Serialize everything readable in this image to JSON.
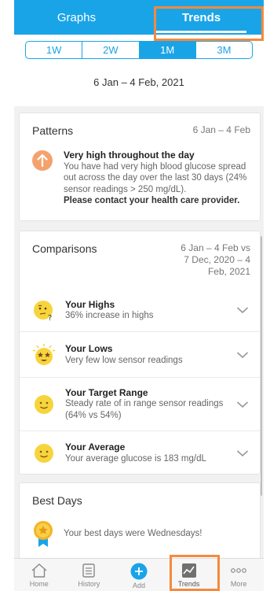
{
  "tabs": [
    {
      "label": "Graphs",
      "active": false
    },
    {
      "label": "Trends",
      "active": true
    }
  ],
  "segments": [
    {
      "label": "1W",
      "active": false
    },
    {
      "label": "2W",
      "active": false
    },
    {
      "label": "1M",
      "active": true
    },
    {
      "label": "3M",
      "active": false
    }
  ],
  "date_range": "6 Jan – 4 Feb, 2021",
  "patterns": {
    "title": "Patterns",
    "date": "6 Jan – 4 Feb",
    "icon": "arrow-up-icon",
    "heading": "Very high throughout the day",
    "body": "You have had very high blood glucose spread out across the day over the last 30 days (24% sensor readings > 250 mg/dL).",
    "contact": "Please contact your health care provider."
  },
  "comparisons": {
    "title": "Comparisons",
    "date_line1": "6 Jan – 4 Feb vs",
    "date_line2": "7 Dec, 2020 – 4",
    "date_line3": "Feb, 2021",
    "items": [
      {
        "title": "Your Highs",
        "desc": "36% increase in highs",
        "icon": "thinking-face-icon"
      },
      {
        "title": "Your Lows",
        "desc": "Very few low sensor readings",
        "icon": "star-eyes-face-icon"
      },
      {
        "title": "Your Target Range",
        "desc": "Steady rate of in range sensor readings (64% vs 54%)",
        "icon": "smiling-face-icon"
      },
      {
        "title": "Your Average",
        "desc": "Your average glucose is 183 mg/dL",
        "icon": "smiling-face-icon"
      }
    ]
  },
  "best_days": {
    "title": "Best Days",
    "text": "Your best days were Wednesdays!",
    "icon": "medal-icon"
  },
  "nav": [
    {
      "label": "Home",
      "icon": "home-icon"
    },
    {
      "label": "History",
      "icon": "history-icon"
    },
    {
      "label": "Add",
      "icon": "add-icon"
    },
    {
      "label": "Trends",
      "icon": "trends-icon",
      "active": true
    },
    {
      "label": "More",
      "icon": "more-icon"
    }
  ],
  "colors": {
    "accent": "#1aa4e8",
    "highlight": "#f58a3c",
    "pattern_icon": "#f4a26d",
    "emoji_yellow": "#f7d43c"
  }
}
